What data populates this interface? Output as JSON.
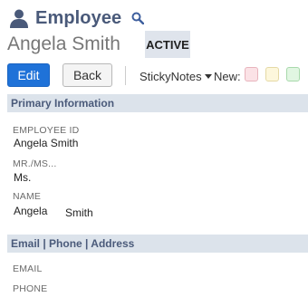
{
  "header": {
    "record_type": "Employee",
    "record_name": "Angela Smith",
    "status": "ACTIVE"
  },
  "toolbar": {
    "edit_label": "Edit",
    "back_label": "Back",
    "sticky_notes_label": "StickyNotes",
    "new_label": "New:"
  },
  "sticky_note_colors": {
    "pink": "#fbe2e6",
    "yellow": "#fdf7dc",
    "green": "#e1f6e2"
  },
  "colors": {
    "accent": "#1f72d8",
    "title": "#4a5a7a",
    "section_bg": "#dce3eb"
  },
  "icons": [
    "person-icon",
    "search-icon",
    "chevron-down-icon"
  ],
  "primary_information": {
    "title": "Primary Information",
    "employee_id": {
      "label": "EMPLOYEE ID",
      "value": "Angela Smith"
    },
    "salutation": {
      "label": "MR./MS...",
      "value": "Ms."
    },
    "name": {
      "label": "NAME",
      "first": "Angela",
      "last": "Smith"
    }
  },
  "contact_section": {
    "title": "Email | Phone | Address",
    "email_label": "EMAIL",
    "phone_label": "PHONE"
  }
}
